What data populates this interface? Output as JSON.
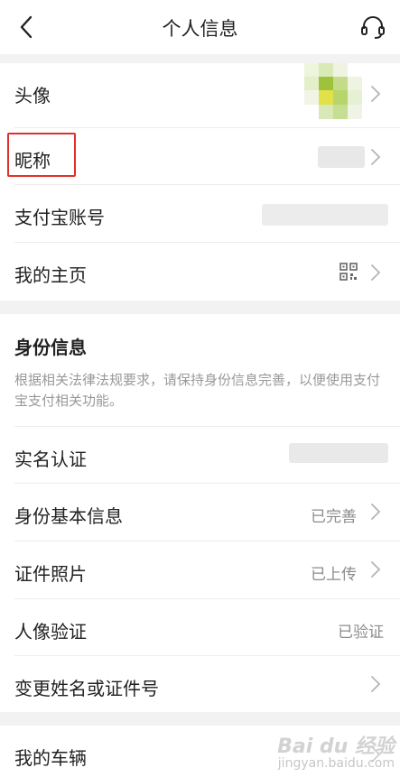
{
  "header": {
    "title": "个人信息"
  },
  "profile": {
    "avatar_label": "头像",
    "nickname_label": "昵称",
    "alipay_account_label": "支付宝账号",
    "homepage_label": "我的主页"
  },
  "identity": {
    "section_title": "身份信息",
    "section_desc": "根据相关法律法规要求，请保持身份信息完善，以便使用支付宝支付相关功能。",
    "realname_label": "实名认证",
    "basic_info_label": "身份基本信息",
    "basic_info_value": "已完善",
    "id_photo_label": "证件照片",
    "id_photo_value": "已上传",
    "face_verify_label": "人像验证",
    "face_verify_value": "已验证",
    "change_name_label": "变更姓名或证件号"
  },
  "vehicle": {
    "my_vehicle_label": "我的车辆"
  },
  "watermark": {
    "brand": "Bai du 经验",
    "url": "jingyan.baidu.com"
  },
  "colors": {
    "highlight": "#e0302b",
    "text_primary": "#222222",
    "text_secondary": "#8c8c8c",
    "background": "#f2f2f2"
  },
  "icons": {
    "back": "chevron-left-icon",
    "service": "headset-icon",
    "row_arrow": "chevron-right-icon",
    "qr": "qr-code-icon"
  }
}
